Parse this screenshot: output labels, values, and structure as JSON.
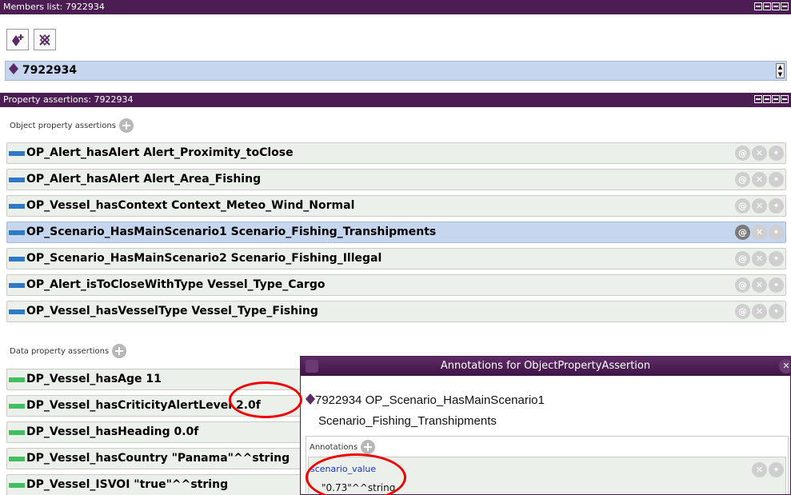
{
  "members_panel": {
    "title": "Members list: 7922934",
    "selected_individual": "7922934"
  },
  "property_panel": {
    "title": "Property assertions: 7922934",
    "object_section_label": "Object property assertions",
    "object_assertions": [
      "OP_Alert_hasAlert  Alert_Proximity_toClose",
      "OP_Alert_hasAlert  Alert_Area_Fishing",
      "OP_Vessel_hasContext  Context_Meteo_Wind_Normal",
      "OP_Scenario_HasMainScenario1  Scenario_Fishing_Transhipments",
      "OP_Scenario_HasMainScenario2  Scenario_Fishing_Illegal",
      "OP_Alert_isToCloseWithType  Vessel_Type_Cargo",
      "OP_Vessel_hasVesselType  Vessel_Type_Fishing"
    ],
    "selected_object_index": 3,
    "data_section_label": "Data property assertions",
    "data_assertions": [
      "DP_Vessel_hasAge  11",
      "DP_Vessel_hasCriticityAlertLevel  2.0f",
      "DP_Vessel_hasHeading  0.0f",
      "DP_Vessel_hasCountry  \"Panama\"^^string",
      "DP_Vessel_ISVOI  \"true\"^^string"
    ]
  },
  "annotation_dialog": {
    "title": "Annotations for ObjectPropertyAssertion",
    "subject_line1": "7922934 OP_Scenario_HasMainScenario1",
    "subject_line2": "Scenario_Fishing_Transhipments",
    "annotations_label": "Annotations",
    "annotation_property": "scenario_value",
    "annotation_value": "\"0.73\"^^string"
  },
  "colors": {
    "title_bar": "#4b1d53",
    "selection": "#c5d6ee",
    "row_bg": "#ecf0ea",
    "object_property_chip": "#2e78c6",
    "data_property_chip": "#3fbf5f",
    "individual_diamond": "#5a2a64",
    "highlight_circle": "#e00000"
  }
}
